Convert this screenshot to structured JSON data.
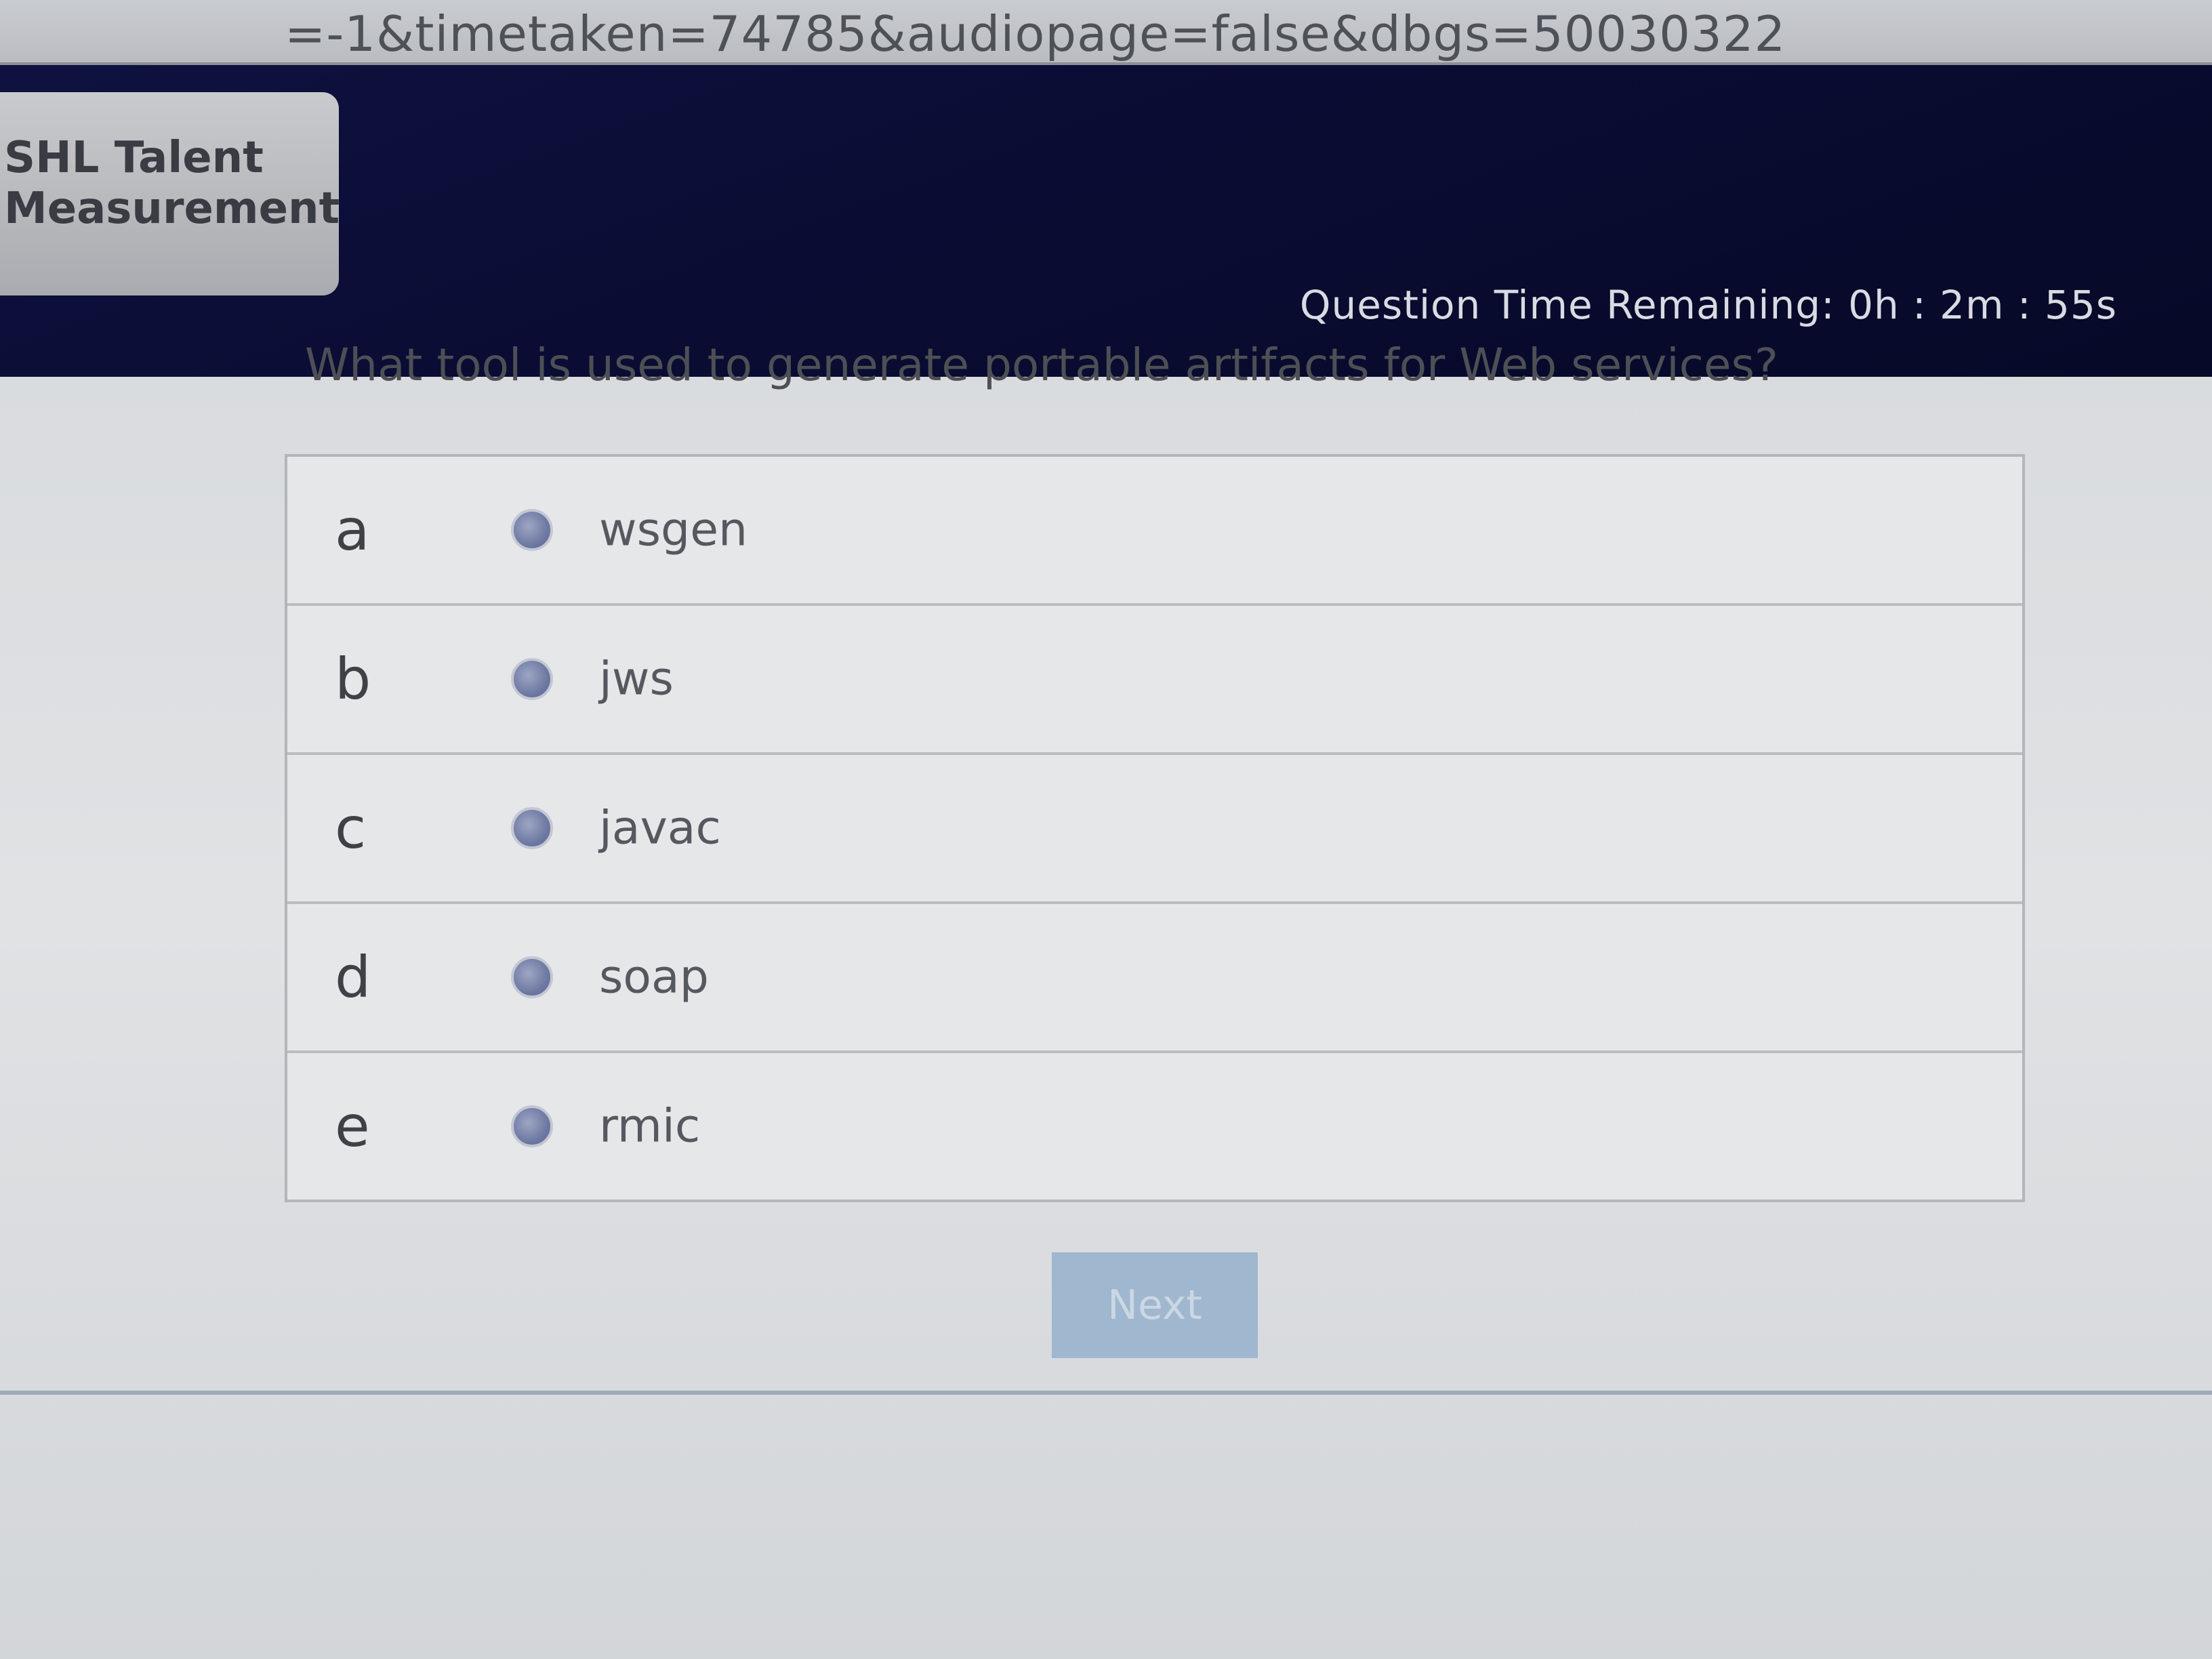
{
  "browser": {
    "url_fragment": "=-1&timetaken=74785&audiopage=false&dbgs=50030322"
  },
  "header": {
    "logo_line1": "SHL Talent",
    "logo_line2": "Measurement",
    "timer": "Question Time Remaining: 0h : 2m : 55s"
  },
  "question": {
    "text": "What tool is used to generate portable artifacts for Web services?",
    "options": [
      {
        "letter": "a",
        "label": "wsgen"
      },
      {
        "letter": "b",
        "label": "jws"
      },
      {
        "letter": "c",
        "label": "javac"
      },
      {
        "letter": "d",
        "label": "soap"
      },
      {
        "letter": "e",
        "label": "rmic"
      }
    ]
  },
  "navigation": {
    "next_label": "Next"
  },
  "colors": {
    "header_bg": "#0a0c33",
    "next_button": "#9fb7cf",
    "radio": "#6f7aa3"
  }
}
